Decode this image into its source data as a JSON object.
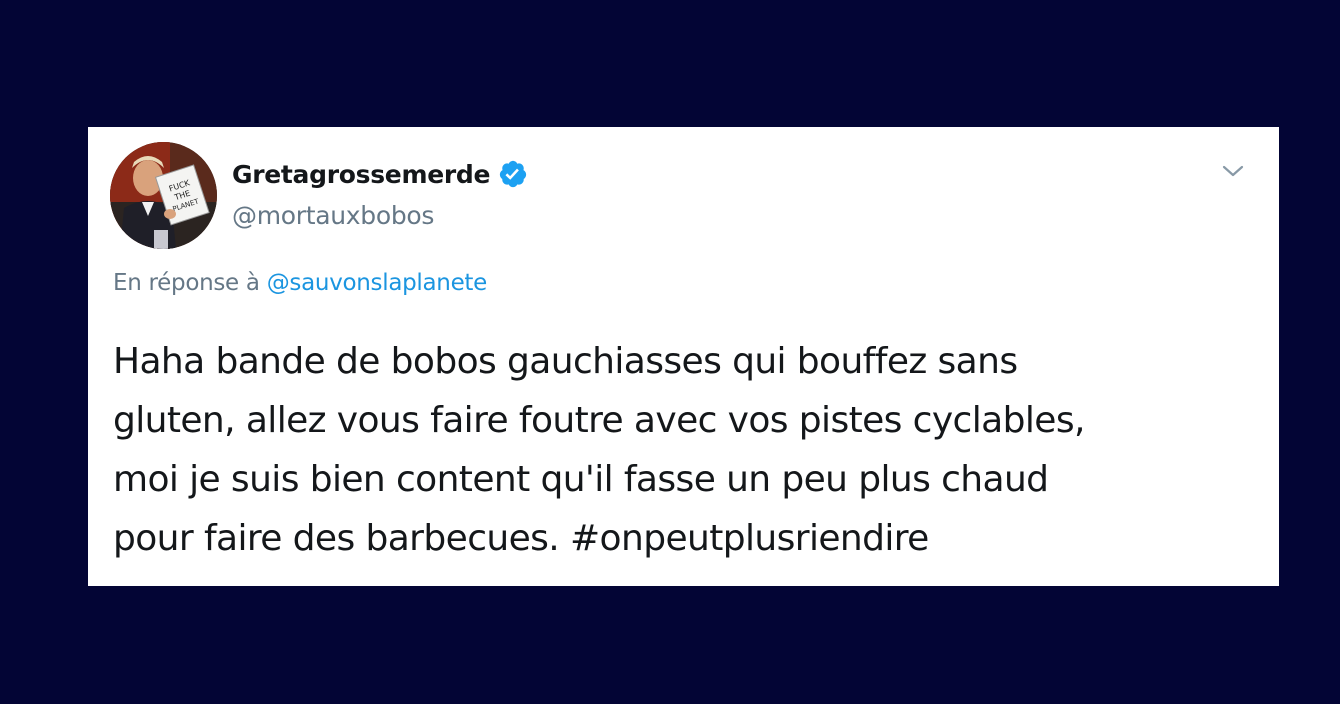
{
  "tweet": {
    "display_name": "Gretagrossemerde",
    "handle": "@mortauxbobos",
    "verified": true,
    "avatar_sign_text": "FUCK THE PLANET",
    "reply_prefix": "En réponse à",
    "reply_to": "@sauvonslaplanete",
    "body_lines": [
      "Haha bande de bobos gauchiasses qui bouffez sans",
      "gluten, allez vous faire foutre avec vos pistes cyclables,",
      "moi je suis bien content qu'il fasse un peu plus chaud",
      "pour faire des barbecues. #onpeutplusriendire"
    ]
  },
  "icons": {
    "verified": "verified-badge-icon",
    "more": "chevron-down-icon"
  },
  "colors": {
    "background": "#030535",
    "card": "#ffffff",
    "text": "#14171a",
    "secondary": "#657786",
    "link": "#1b95e0",
    "verified": "#1da1f2"
  }
}
